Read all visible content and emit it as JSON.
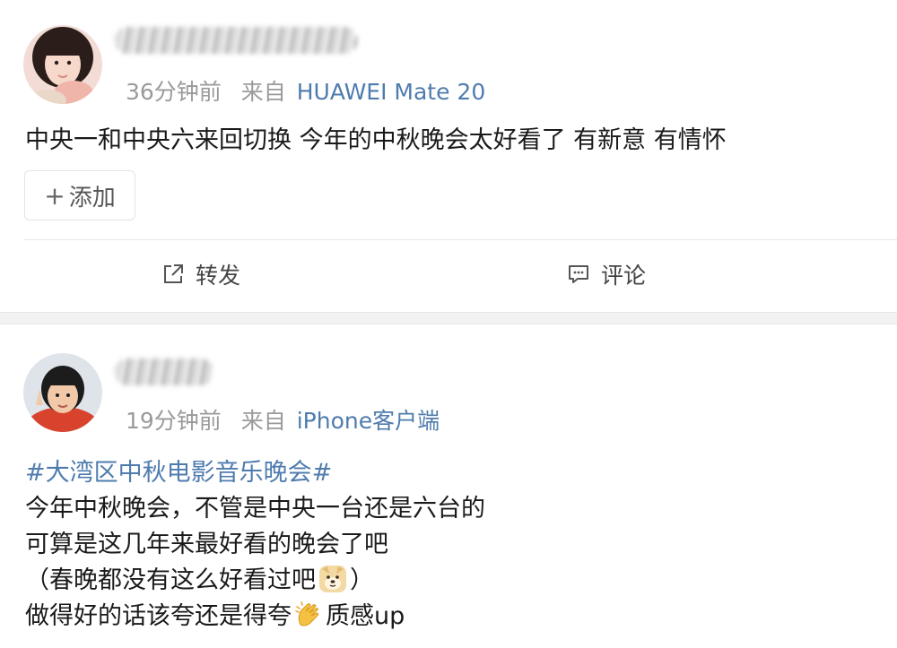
{
  "posts": [
    {
      "time": "36分钟前",
      "source_prefix": "来自",
      "source_device": "HUAWEI Mate 20",
      "content": "中央一和中央六来回切换 今年的中秋晚会太好看了 有新意 有情怀",
      "add_tag_icon": "+",
      "add_tag_label": "添加",
      "actions": {
        "repost_label": "转发",
        "comment_label": "评论"
      }
    },
    {
      "time": "19分钟前",
      "source_prefix": "来自",
      "source_device": "iPhone客户端",
      "hashtag": "#大湾区中秋电影音乐晚会#",
      "lines": [
        "今年中秋晚会，不管是中央一台还是六台的",
        "可算是这几年来最好看的晚会了吧",
        "（春晚都没有这么好看过吧",
        "）",
        "做得好的话该夸还是得夸",
        "质感up"
      ]
    }
  ],
  "icons": {
    "repost": "repost-icon",
    "comment": "comment-icon",
    "doge_emoji": "doge-emoji",
    "clap_emoji": "clapping-hands-emoji"
  },
  "colors": {
    "link_blue": "#4f7cae",
    "meta_gray": "#9a9a9a",
    "separator": "#f2f2f2"
  }
}
